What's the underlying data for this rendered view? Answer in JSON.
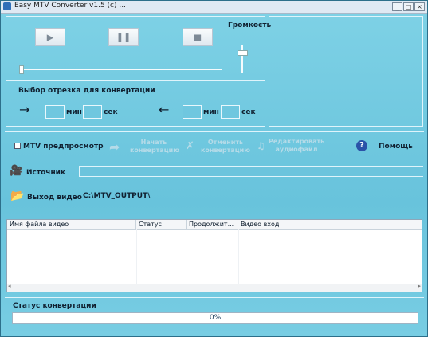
{
  "window": {
    "title": "Easy MTV Converter v1.5 (c) ...",
    "minimize": "_",
    "maximize": "□",
    "close": "×"
  },
  "player": {
    "volume_label": "Громкость"
  },
  "segment": {
    "title": "Выбор отрезка для конвертации",
    "start_min_label": "мин",
    "start_sec_label": "сек",
    "end_min_label": "мин",
    "end_sec_label": "сек"
  },
  "toolbar": {
    "preview_label": "MTV предпросмотр",
    "start_convert_label": "Начать конвертацию",
    "stop_convert_label": "Отменить конвертацию",
    "edit_audio_label": "Редактировать аудиофайл",
    "help_label": "Помощь"
  },
  "source": {
    "label": "Источник",
    "value": ""
  },
  "output": {
    "label": "Выход видео",
    "path": "C:\\MTV_OUTPUT\\"
  },
  "table": {
    "columns": [
      "Имя файла видео",
      "Статус",
      "Продолжит...",
      "Видео вход"
    ]
  },
  "status": {
    "label": "Статус конвертации",
    "progress_text": "0%",
    "progress_value": 0
  },
  "colors": {
    "background": "#68c3dc",
    "panel_border": "#dff4fb"
  }
}
